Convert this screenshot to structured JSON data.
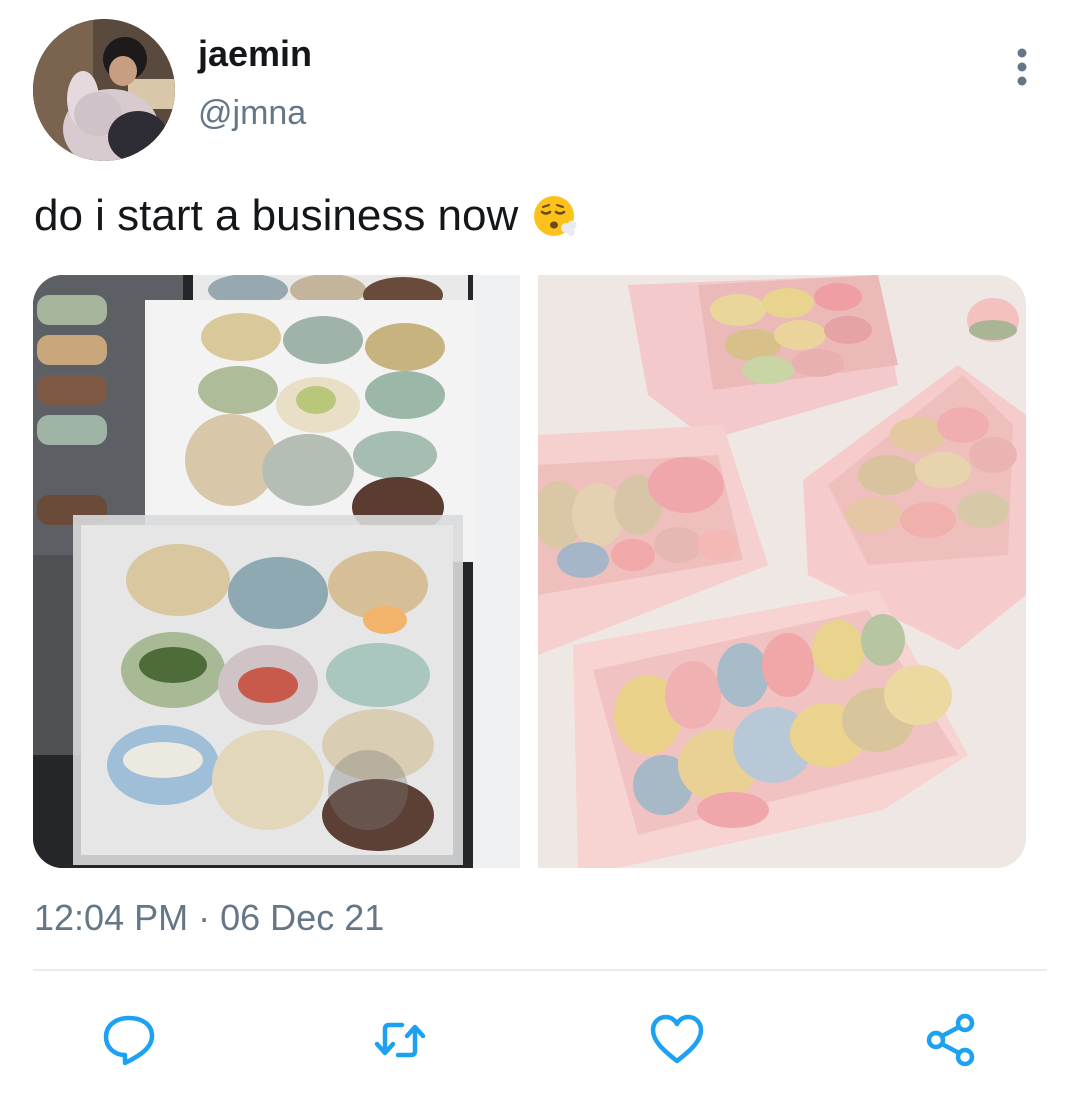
{
  "tweet": {
    "author": {
      "display_name": "jaemin",
      "handle": "@jmna",
      "avatar": "avatar-photo"
    },
    "text": "do i start a business now",
    "emoji": "face-exhaling-emoji",
    "media": [
      {
        "name": "macaron-boxes-photo-left",
        "icon": "photo"
      },
      {
        "name": "macaron-boxes-photo-right",
        "icon": "photo"
      }
    ],
    "time": "12:04 PM",
    "separator": "·",
    "date": "06 Dec 21"
  },
  "actions": [
    {
      "name": "reply",
      "icon": "reply-icon"
    },
    {
      "name": "retweet",
      "icon": "retweet-icon"
    },
    {
      "name": "like",
      "icon": "like-icon"
    },
    {
      "name": "share",
      "icon": "share-icon"
    }
  ],
  "colors": {
    "text_primary": "#14171a",
    "text_secondary": "#657786",
    "action_icon": "#1da1f2",
    "divider": "#e6ecf0"
  }
}
